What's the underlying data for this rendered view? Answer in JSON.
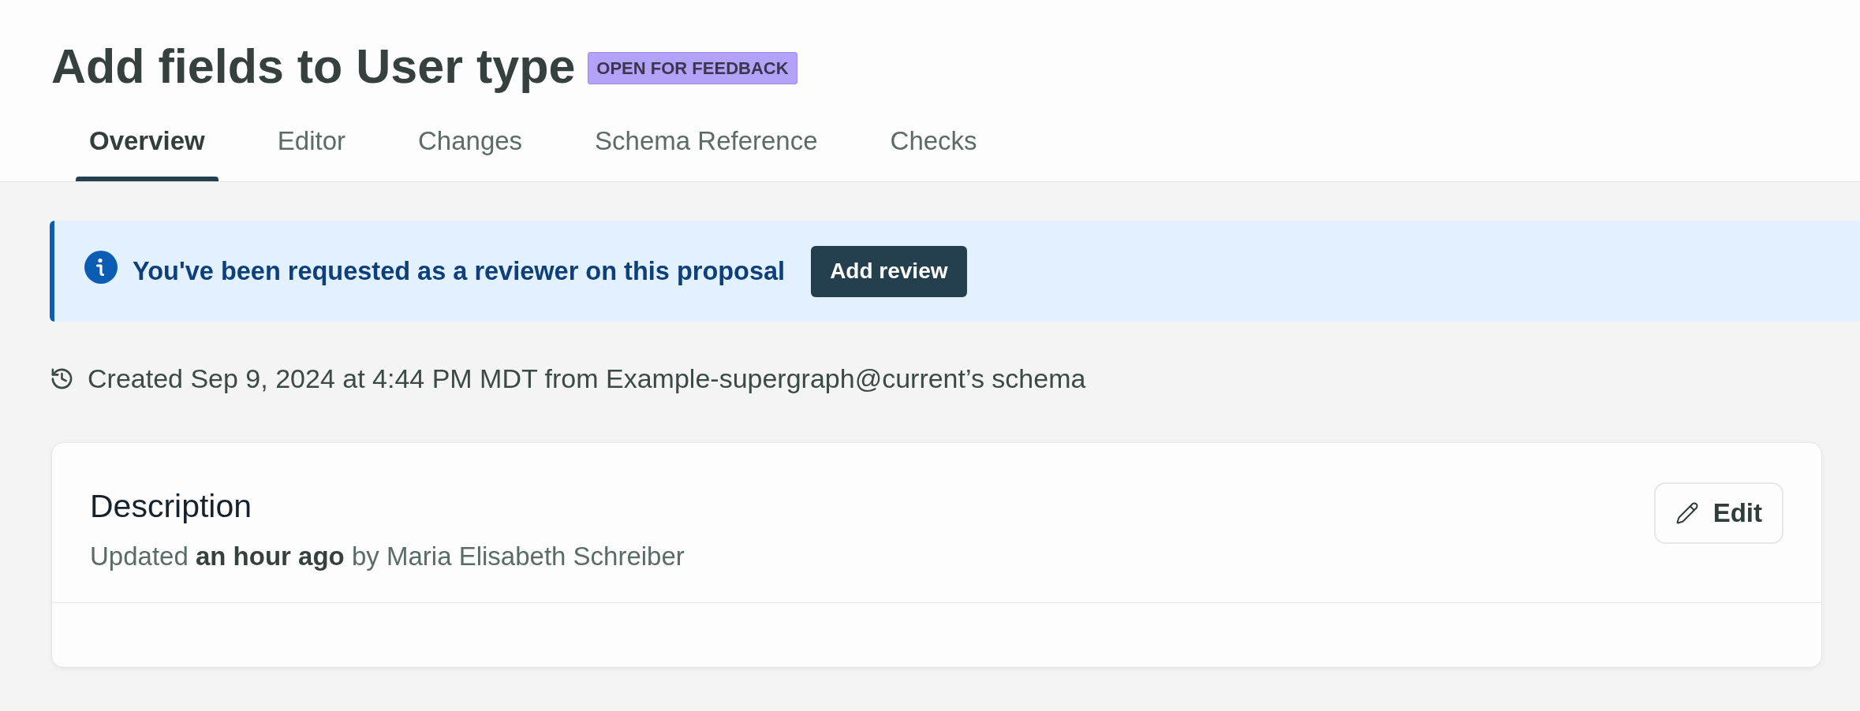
{
  "header": {
    "title": "Add fields to User type",
    "badge": "OPEN FOR FEEDBACK"
  },
  "tabs": [
    {
      "label": "Overview",
      "selected": true
    },
    {
      "label": "Editor",
      "selected": false
    },
    {
      "label": "Changes",
      "selected": false
    },
    {
      "label": "Schema Reference",
      "selected": false
    },
    {
      "label": "Checks",
      "selected": false
    }
  ],
  "banner": {
    "message": "You've been requested as a reviewer on this proposal",
    "button": "Add review"
  },
  "created_line": "Created Sep 9, 2024 at 4:44 PM MDT from Example-supergraph@current’s schema",
  "description_card": {
    "title": "Description",
    "meta": "Updated **an hour ago** by Maria Elisabeth Schreiber",
    "edit_button": "Edit"
  }
}
